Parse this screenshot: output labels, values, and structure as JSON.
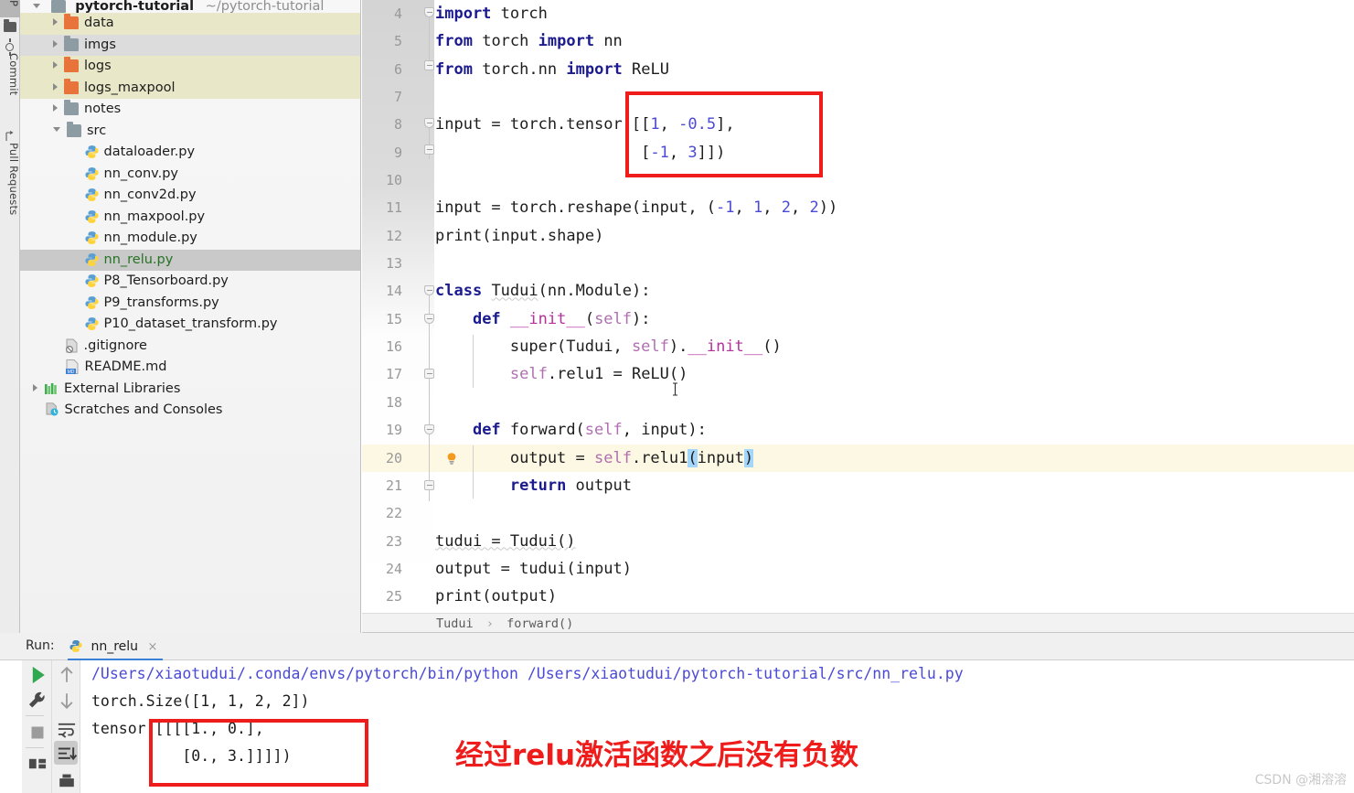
{
  "ide": {
    "tool_tabs": [
      {
        "label": "P",
        "name": "project"
      },
      {
        "label": "Commit",
        "name": "commit"
      },
      {
        "label": "Pull Requests",
        "name": "pull-requests"
      }
    ]
  },
  "project_tree": {
    "root": {
      "name": "pytorch-tutorial",
      "path": "~/pytorch-tutorial"
    },
    "items": [
      {
        "label": "data",
        "icon": "folder-orange",
        "arrow": "right",
        "indent": 1,
        "hl": "yellow"
      },
      {
        "label": "imgs",
        "icon": "folder",
        "arrow": "right",
        "indent": 1,
        "hl": "grey"
      },
      {
        "label": "logs",
        "icon": "folder-orange",
        "arrow": "right",
        "indent": 1,
        "hl": "yellow"
      },
      {
        "label": "logs_maxpool",
        "icon": "folder-orange",
        "arrow": "right",
        "indent": 1,
        "hl": "yellow"
      },
      {
        "label": "notes",
        "icon": "folder",
        "arrow": "right",
        "indent": 1,
        "hl": "none"
      },
      {
        "label": "src",
        "icon": "folder",
        "arrow": "down",
        "indent": 1,
        "hl": "none"
      },
      {
        "label": "dataloader.py",
        "icon": "python",
        "arrow": "none",
        "indent": 2,
        "hl": "none"
      },
      {
        "label": "nn_conv.py",
        "icon": "python",
        "arrow": "none",
        "indent": 2,
        "hl": "none"
      },
      {
        "label": "nn_conv2d.py",
        "icon": "python",
        "arrow": "none",
        "indent": 2,
        "hl": "none"
      },
      {
        "label": "nn_maxpool.py",
        "icon": "python",
        "arrow": "none",
        "indent": 2,
        "hl": "none"
      },
      {
        "label": "nn_module.py",
        "icon": "python",
        "arrow": "none",
        "indent": 2,
        "hl": "none"
      },
      {
        "label": "nn_relu.py",
        "icon": "python",
        "arrow": "none",
        "indent": 2,
        "hl": "selected",
        "green": true
      },
      {
        "label": "P8_Tensorboard.py",
        "icon": "python",
        "arrow": "none",
        "indent": 2,
        "hl": "none"
      },
      {
        "label": "P9_transforms.py",
        "icon": "python",
        "arrow": "none",
        "indent": 2,
        "hl": "none"
      },
      {
        "label": "P10_dataset_transform.py",
        "icon": "python",
        "arrow": "none",
        "indent": 2,
        "hl": "none"
      },
      {
        "label": ".gitignore",
        "icon": "gitignore",
        "arrow": "none",
        "indent": 1,
        "hl": "none"
      },
      {
        "label": "README.md",
        "icon": "markdown",
        "arrow": "none",
        "indent": 1,
        "hl": "none"
      },
      {
        "label": "External Libraries",
        "icon": "library",
        "arrow": "right",
        "indent": 0,
        "hl": "none"
      },
      {
        "label": "Scratches and Consoles",
        "icon": "scratches",
        "arrow": "none",
        "indent": 0,
        "hl": "none"
      }
    ]
  },
  "editor": {
    "lines": [
      {
        "n": "4",
        "text": "import torch"
      },
      {
        "n": "5",
        "text": "from torch import nn"
      },
      {
        "n": "6",
        "text": "from torch.nn import ReLU"
      },
      {
        "n": "7",
        "text": ""
      },
      {
        "n": "8",
        "text": "input = torch.tensor([[1, -0.5],"
      },
      {
        "n": "9",
        "text": "                      [-1, 3]])"
      },
      {
        "n": "10",
        "text": ""
      },
      {
        "n": "11",
        "text": "input = torch.reshape(input, (-1, 1, 2, 2))"
      },
      {
        "n": "12",
        "text": "print(input.shape)"
      },
      {
        "n": "13",
        "text": ""
      },
      {
        "n": "14",
        "text": "class Tudui(nn.Module):"
      },
      {
        "n": "15",
        "text": "    def __init__(self):"
      },
      {
        "n": "16",
        "text": "        super(Tudui, self).__init__()"
      },
      {
        "n": "17",
        "text": "        self.relu1 = ReLU()"
      },
      {
        "n": "18",
        "text": ""
      },
      {
        "n": "19",
        "text": "    def forward(self, input):"
      },
      {
        "n": "20",
        "text": "        output = self.relu1(input)",
        "current": true
      },
      {
        "n": "21",
        "text": "        return output"
      },
      {
        "n": "22",
        "text": ""
      },
      {
        "n": "23",
        "text": "tudui = Tudui()"
      },
      {
        "n": "24",
        "text": "output = tudui(input)"
      },
      {
        "n": "25",
        "text": "print(output)"
      }
    ],
    "breadcrumb": {
      "class": "Tudui",
      "separator": "›",
      "method": "forward()"
    }
  },
  "run_panel": {
    "label": "Run:",
    "tab_name": "nn_relu",
    "tab_close": "×",
    "toolbar": [
      {
        "name": "rerun-button"
      },
      {
        "name": "settings-wrench-button"
      },
      {
        "name": "stop-button"
      },
      {
        "name": "layout-button"
      },
      {
        "name": "scroll-up-button"
      },
      {
        "name": "scroll-down-button"
      },
      {
        "name": "soft-wrap-button"
      },
      {
        "name": "scroll-to-end-button"
      },
      {
        "name": "print-button"
      }
    ],
    "console_lines": [
      {
        "text": "/Users/xiaotudui/.conda/envs/pytorch/bin/python /Users/xiaotudui/pytorch-tutorial/src/nn_relu.py",
        "style": "path"
      },
      {
        "text": "torch.Size([1, 1, 2, 2])",
        "style": "normal"
      },
      {
        "text": "tensor([[[[1., 0.],",
        "style": "normal"
      },
      {
        "text": "          [0., 3.]]]])",
        "style": "normal"
      }
    ]
  },
  "annotations": {
    "note_text": "经过relu激活函数之后没有负数",
    "note_color": "#ef1c1c",
    "box_color": "#ef1c1c",
    "watermark": "CSDN @湘溶溶"
  },
  "colors": {
    "accent_blue": "#3a80d6",
    "keyword": "#1b1b8f",
    "number": "#4a4ad6",
    "self_param": "#b06fb0",
    "dunder": "#b4309a",
    "selection": "#a4d5fb",
    "current_line": "#fdf8e3",
    "folder_orange": "#e8743b",
    "folder_grey": "#8d9ca3"
  }
}
